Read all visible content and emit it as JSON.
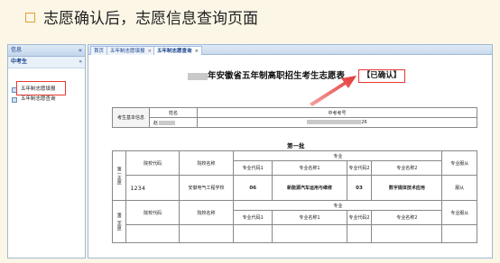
{
  "slide": {
    "title": "志愿确认后，志愿信息查询页面"
  },
  "sidebar": {
    "header": "信息",
    "collapse_glyph": "«",
    "section": "中考生",
    "section_collapse_glyph": "«",
    "items": [
      {
        "label": "五年制志愿填报"
      },
      {
        "label": "五年制志愿查询"
      }
    ]
  },
  "tabs": [
    {
      "label": "首页"
    },
    {
      "label": "五年制志愿填报",
      "close": "×"
    },
    {
      "label": "五年制志愿查询",
      "close": "×"
    }
  ],
  "form": {
    "title": "年安徽省五年制高职招生考生志愿表",
    "status": "【已确认】",
    "info": {
      "row_label": "考生基本信息",
      "name_header": "姓名",
      "exam_no_header": "中考考号",
      "name_value": "赵",
      "exam_no_value": "26"
    },
    "batch_title": "第一批",
    "headers": {
      "school_code": "院校代码",
      "school_name": "院校名称",
      "major": "专业",
      "obey": "专业服从",
      "major_code": "专业代码",
      "major_name": "专业名称"
    },
    "choices": [
      {
        "label": "第一志愿",
        "school_code": "1234",
        "school_name": "安徽电气工程学校",
        "majors": [
          {
            "code_header": "专业代码1",
            "name_header": "专业名称1",
            "code": "06",
            "name": "新能源汽车运用与维修"
          },
          {
            "code_header": "专业代码2",
            "name_header": "专业名称2",
            "code": "03",
            "name": "数字媒体技术应用"
          }
        ],
        "obey": "服从"
      },
      {
        "label": "第二志愿",
        "school_code": "",
        "school_name": "",
        "majors": [
          {
            "code_header": "专业代码1",
            "name_header": "专业名称1",
            "code": "",
            "name": ""
          },
          {
            "code_header": "专业代码2",
            "name_header": "专业名称2",
            "code": "",
            "name": ""
          }
        ],
        "obey": ""
      }
    ]
  }
}
